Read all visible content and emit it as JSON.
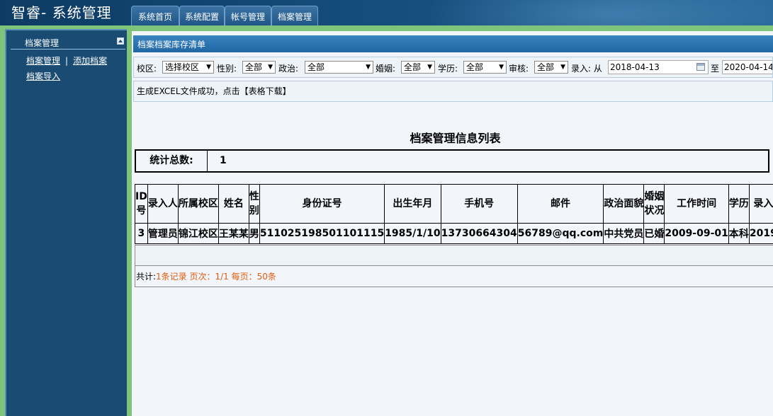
{
  "header": {
    "logo": "智睿- 系统管理",
    "tabs": [
      {
        "label": "系统首页"
      },
      {
        "label": "系统配置"
      },
      {
        "label": "帐号管理"
      },
      {
        "label": "档案管理"
      }
    ]
  },
  "sidebar": {
    "title": "档案管理",
    "links": {
      "manage": "档案管理",
      "separator": "|",
      "add": "添加档案",
      "import": "档案导入"
    }
  },
  "main": {
    "panel_title": "档案档案库存清单",
    "filters": {
      "campus_label": "校区:",
      "campus_value": "选择校区",
      "gender_label": "性别:",
      "gender_value": "全部",
      "political_label": "政治:",
      "political_value": "全部",
      "marital_label": "婚姻:",
      "marital_value": "全部",
      "education_label": "学历:",
      "education_value": "全部",
      "review_label": "审核:",
      "review_value": "全部",
      "entry_label": "录入: 从",
      "date_from": "2018-04-13",
      "to_label": "至",
      "date_to": "2020-04-14"
    },
    "message": "生成EXCEL文件成功，点击【表格下载】",
    "report_title": "档案管理信息列表",
    "stats": {
      "label": "统计总数:",
      "value": "1"
    },
    "table": {
      "columns": [
        "ID号",
        "录入人",
        "所属校区",
        "姓名",
        "性别",
        "身份证号",
        "出生年月",
        "手机号",
        "邮件",
        "政治面貌",
        "婚姻状况",
        "工作时间",
        "学历",
        "录入"
      ],
      "rows": [
        [
          "3",
          "管理员",
          "锦江校区",
          "王某某",
          "男",
          "511025198501101115",
          "1985/1/10",
          "13730664304",
          "56789@qq.com",
          "中共党员",
          "已婚",
          "2009-09-01",
          "本科",
          "2019"
        ]
      ]
    },
    "pager": {
      "prefix": "共计:",
      "info": "1条记录 页次：1/1 每页：50条"
    }
  }
}
